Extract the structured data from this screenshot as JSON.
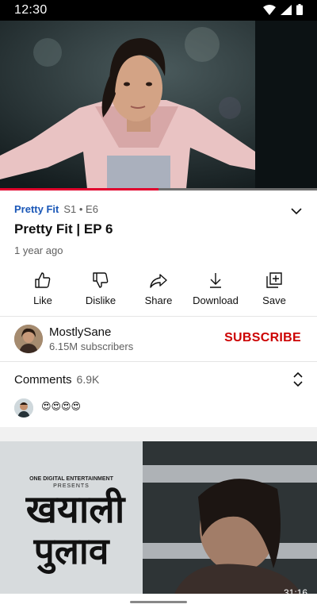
{
  "status_bar": {
    "time": "12:30"
  },
  "player": {
    "progress_fraction": 0.5
  },
  "video": {
    "series_name": "Pretty Fit",
    "episode": "S1 • E6",
    "title": "Pretty Fit | EP 6",
    "age": "1 year ago"
  },
  "actions": [
    {
      "label": "Like",
      "icon": "thumbs-up-icon"
    },
    {
      "label": "Dislike",
      "icon": "thumbs-down-icon"
    },
    {
      "label": "Share",
      "icon": "share-icon"
    },
    {
      "label": "Download",
      "icon": "download-icon"
    },
    {
      "label": "Save",
      "icon": "add-to-playlist-icon"
    }
  ],
  "channel": {
    "name": "MostlySane",
    "subscribers": "6.15M subscribers",
    "subscribe_label": "SUBSCRIBE"
  },
  "comments": {
    "heading": "Comments",
    "count": "6.9K",
    "top_comment": "😍😍😍😍"
  },
  "next_video": {
    "thumbnail_caption_top": "ONE DIGITAL ENTERTAINMENT",
    "thumbnail_caption_sub": "PRESENTS",
    "thumbnail_title_line1": "खयाली",
    "thumbnail_title_line2": "पुलाव",
    "duration": "31:16"
  },
  "colors": {
    "accent_red": "#cc0000",
    "progress_red": "#e1002d",
    "link_blue": "#1a57b7"
  }
}
